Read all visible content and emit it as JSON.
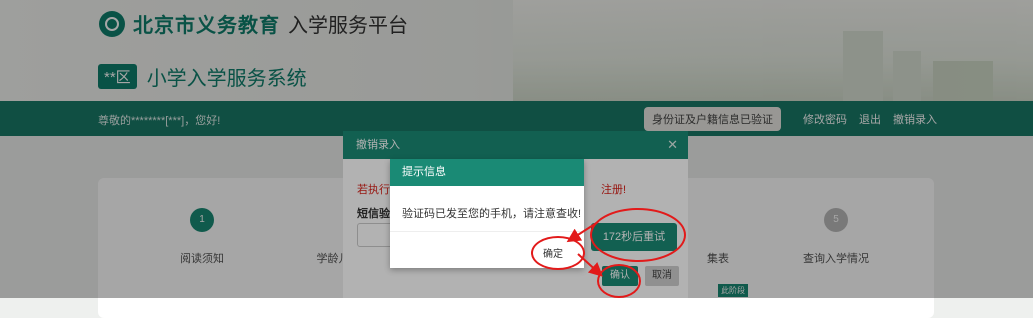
{
  "header": {
    "logo_bold": "北京市义务教育",
    "logo_rest": "入学服务平台",
    "district_badge": "**区",
    "system_title": "小学入学服务系统"
  },
  "nav": {
    "greeting": "尊敬的********[***]，您好!",
    "verified_badge": "身份证及户籍信息已验证",
    "links": [
      "修改密码",
      "退出",
      "撤销录入"
    ]
  },
  "steps": [
    {
      "number": "1",
      "label": "阅读须知"
    },
    {
      "number": "",
      "label": "学龄儿"
    },
    {
      "number": "",
      "label": "集表"
    },
    {
      "number": "5",
      "label": "查询入学情况"
    }
  ],
  "step_tag": "此阶段",
  "modal": {
    "title": "撤销录入",
    "close_icon": "close-icon",
    "warning_start": "若执行",
    "warning_end": "注册!",
    "sms_label": "短信验证",
    "resend_button": "172秒后重试",
    "confirm_button": "确认",
    "cancel_button": "取消"
  },
  "dialog": {
    "title": "提示信息",
    "message": "验证码已发至您的手机，请注意查收!",
    "ok_button": "确定"
  },
  "colors": {
    "brand_green": "#1a8a75",
    "annotation_red": "#e21a1a",
    "warning_red": "#d9231c"
  }
}
